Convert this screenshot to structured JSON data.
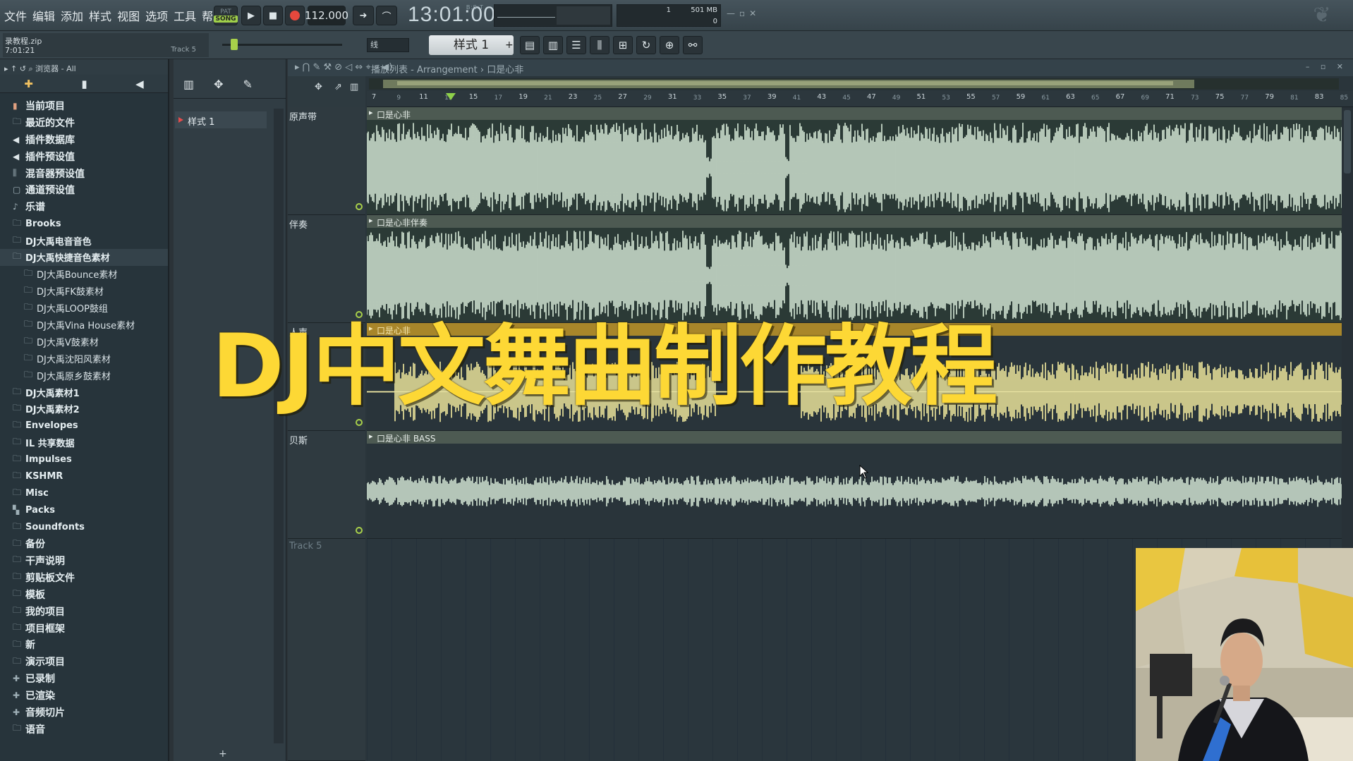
{
  "menu": [
    "文件",
    "编辑",
    "添加",
    "样式",
    "视图",
    "选项",
    "工具",
    "帮助"
  ],
  "transport": {
    "mode_top": "PAT",
    "mode_label": "SONG",
    "tempo": "112.000",
    "time": "13:01:00",
    "time_unit": "B:S:T"
  },
  "cpu": {
    "voices": "1",
    "memory": "501 MB",
    "polyphony": "0"
  },
  "hint": {
    "title": "录教程.zip",
    "time": "7:01:21",
    "track": "Track 5"
  },
  "snap": "线",
  "pattern_select": "样式 1",
  "browser": {
    "header": "浏览器 - All",
    "items": [
      {
        "label": "当前项目",
        "icon": "project-icon",
        "level": 0
      },
      {
        "label": "最近的文件",
        "icon": "folder-icon",
        "level": 0
      },
      {
        "label": "插件数据库",
        "icon": "plugin-icon",
        "level": 0
      },
      {
        "label": "插件预设值",
        "icon": "plugin-icon",
        "level": 0
      },
      {
        "label": "混音器预设值",
        "icon": "mixer-icon",
        "level": 0
      },
      {
        "label": "通道预设值",
        "icon": "channel-icon",
        "level": 0
      },
      {
        "label": "乐谱",
        "icon": "note-icon",
        "level": 0
      },
      {
        "label": "Brooks",
        "icon": "folder-icon",
        "level": 0
      },
      {
        "label": "DJ大禹电音音色",
        "icon": "folder-icon",
        "level": 0
      },
      {
        "label": "DJ大禹快捷音色素材",
        "icon": "folder-icon",
        "level": 0
      },
      {
        "label": "DJ大禹Bounce素材",
        "icon": "folder-icon",
        "level": 1
      },
      {
        "label": "DJ大禹FK鼓素材",
        "icon": "folder-icon",
        "level": 1
      },
      {
        "label": "DJ大禹LOOP鼓组",
        "icon": "folder-icon",
        "level": 1
      },
      {
        "label": "DJ大禹Vina House素材",
        "icon": "folder-icon",
        "level": 1
      },
      {
        "label": "DJ大禹V鼓素材",
        "icon": "folder-icon",
        "level": 1
      },
      {
        "label": "DJ大禹沈阳风素材",
        "icon": "folder-icon",
        "level": 1
      },
      {
        "label": "DJ大禹原乡鼓素材",
        "icon": "folder-icon",
        "level": 1
      },
      {
        "label": "DJ大禹素材1",
        "icon": "folder-icon",
        "level": 0
      },
      {
        "label": "DJ大禹素材2",
        "icon": "folder-icon",
        "level": 0
      },
      {
        "label": "Envelopes",
        "icon": "folder-icon",
        "level": 0
      },
      {
        "label": "IL 共享数据",
        "icon": "folder-icon",
        "level": 0
      },
      {
        "label": "Impulses",
        "icon": "folder-icon",
        "level": 0
      },
      {
        "label": "KSHMR",
        "icon": "folder-icon",
        "level": 0
      },
      {
        "label": "Misc",
        "icon": "folder-icon",
        "level": 0
      },
      {
        "label": "Packs",
        "icon": "packs-icon",
        "level": 0
      },
      {
        "label": "Soundfonts",
        "icon": "folder-icon",
        "level": 0
      },
      {
        "label": "备份",
        "icon": "folder-icon",
        "level": 0
      },
      {
        "label": "干声说明",
        "icon": "folder-icon",
        "level": 0
      },
      {
        "label": "剪贴板文件",
        "icon": "folder-icon",
        "level": 0
      },
      {
        "label": "模板",
        "icon": "folder-icon",
        "level": 0
      },
      {
        "label": "我的项目",
        "icon": "folder-icon",
        "level": 0
      },
      {
        "label": "项目框架",
        "icon": "folder-icon",
        "level": 0
      },
      {
        "label": "新",
        "icon": "folder-icon",
        "level": 0
      },
      {
        "label": "演示项目",
        "icon": "folder-icon",
        "level": 0
      },
      {
        "label": "已录制",
        "icon": "record-icon",
        "level": 0
      },
      {
        "label": "已渲染",
        "icon": "render-icon",
        "level": 0
      },
      {
        "label": "音频切片",
        "icon": "slice-icon",
        "level": 0
      },
      {
        "label": "语音",
        "icon": "folder-icon",
        "level": 0
      }
    ]
  },
  "pattern_list": {
    "item": "样式 1",
    "add": "+"
  },
  "playlist": {
    "title": "播放列表 - Arrangement",
    "breadcrumb": "口是心非",
    "ruler": [
      7,
      9,
      11,
      13,
      15,
      17,
      19,
      21,
      23,
      25,
      27,
      29,
      31,
      33,
      35,
      37,
      39,
      41,
      43,
      45,
      47,
      49,
      51,
      53,
      55,
      57,
      59,
      61,
      63,
      65,
      67,
      69,
      71,
      73,
      75,
      77,
      79,
      81,
      83,
      85
    ],
    "tracks": [
      {
        "name": "原声带",
        "clip": "口是心非"
      },
      {
        "name": "伴奏",
        "clip": "口是心非伴奏"
      },
      {
        "name": "人声",
        "clip": "口是心非"
      },
      {
        "name": "贝斯",
        "clip": "口是心非 BASS"
      },
      {
        "name": "Track 5",
        "clip": ""
      }
    ]
  },
  "overlay_title": "DJ中文舞曲制作教程",
  "colors": {
    "wave_light": "#d7ead8",
    "wave_vocal": "#f3eb9e",
    "overlay": "#fdd835",
    "accent_green": "#a8d04a"
  }
}
